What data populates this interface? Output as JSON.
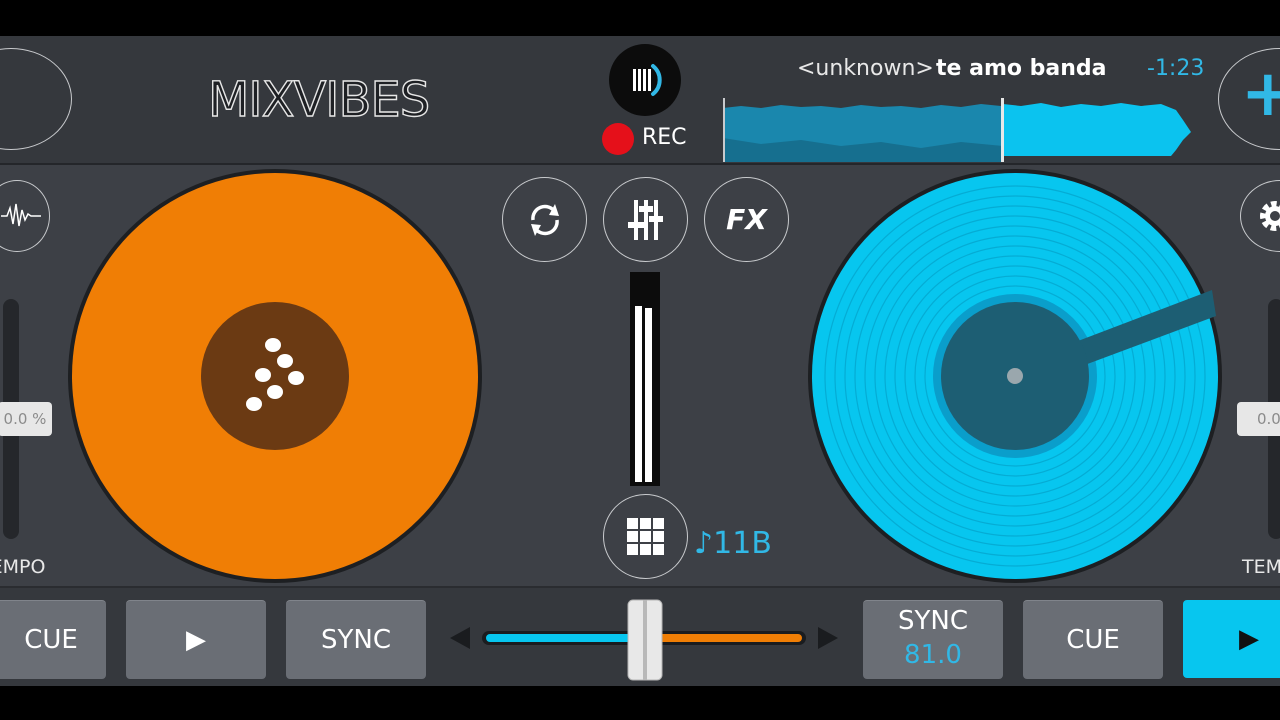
{
  "app": {
    "logo": "MIXVIBES"
  },
  "recorder": {
    "label": "REC"
  },
  "track": {
    "artist": "<unknown>",
    "title": "te amo banda",
    "remaining": "-1:23",
    "played_fraction": 0.59
  },
  "left_deck": {
    "color": "#f07e05",
    "pitch_value": "0.0 %",
    "tempo_label": "TEMPO",
    "cue_label": "CUE",
    "play_label": "▶",
    "sync_label": "SYNC"
  },
  "right_deck": {
    "color": "#07c6ef",
    "pitch_value": "0.0",
    "tempo_label": "TEMPO",
    "cue_label": "CUE",
    "play_label": "▶",
    "sync_label": "SYNC",
    "bpm": "81.0"
  },
  "mixer": {
    "fx_label": "FX",
    "key": "♪11B",
    "crossfader_position": 0.5,
    "add_label": "+"
  },
  "colors": {
    "accent_blue": "#31b8e6",
    "accent_orange": "#f07e05",
    "record": "#e5101a"
  },
  "icons": [
    "vinyl-icon",
    "recorder-icon",
    "waveform-icon",
    "sync-loop-icon",
    "mixer-sliders-icon",
    "fx-icon",
    "sampler-grid-icon",
    "settings-gear-icon",
    "plus-icon",
    "play-icon"
  ]
}
